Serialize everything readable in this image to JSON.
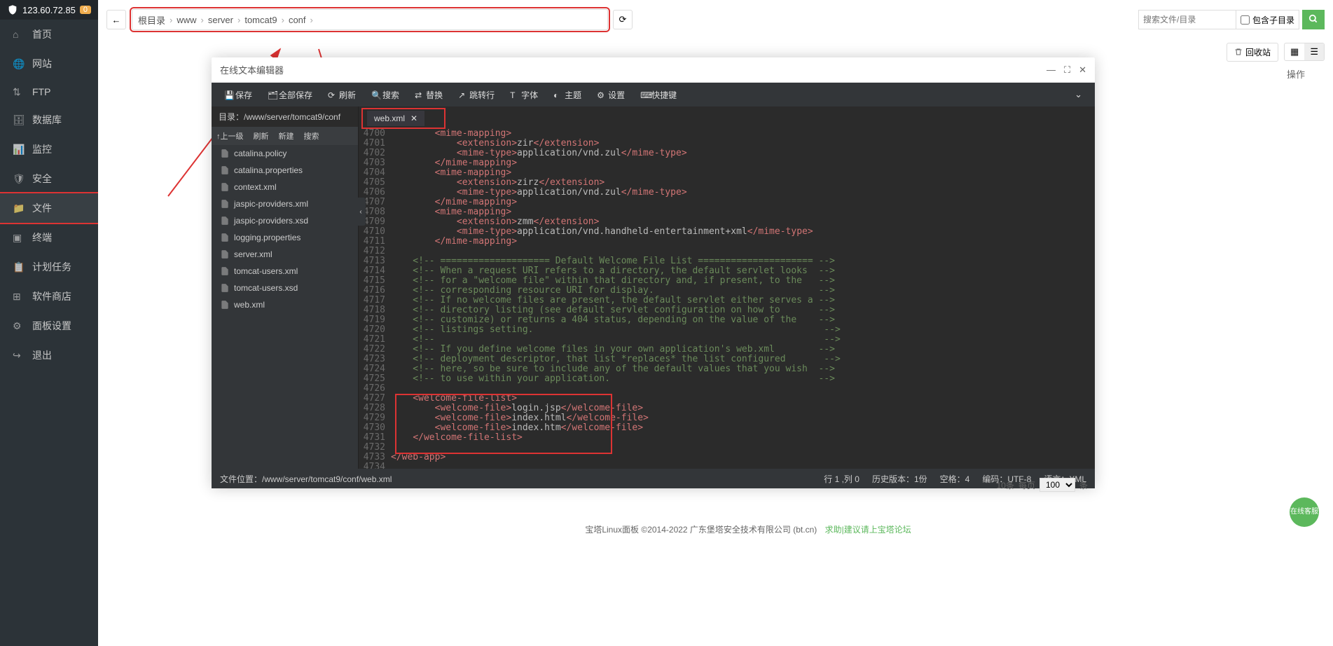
{
  "sidebar": {
    "ip": "123.60.72.85",
    "badge": "0",
    "items": [
      {
        "icon": "home",
        "label": "首页"
      },
      {
        "icon": "globe",
        "label": "网站"
      },
      {
        "icon": "ftp",
        "label": "FTP"
      },
      {
        "icon": "db",
        "label": "数据库"
      },
      {
        "icon": "monitor",
        "label": "监控"
      },
      {
        "icon": "shield",
        "label": "安全"
      },
      {
        "icon": "folder",
        "label": "文件",
        "active": true
      },
      {
        "icon": "terminal",
        "label": "终端"
      },
      {
        "icon": "calendar",
        "label": "计划任务"
      },
      {
        "icon": "apps",
        "label": "软件商店"
      },
      {
        "icon": "gear",
        "label": "面板设置"
      },
      {
        "icon": "exit",
        "label": "退出"
      }
    ]
  },
  "breadcrumb": [
    "根目录",
    "www",
    "server",
    "tomcat9",
    "conf"
  ],
  "search": {
    "placeholder": "搜索文件/目录",
    "subdir": "包含子目录"
  },
  "toolbar": {
    "recycle": "回收站",
    "action": "操作"
  },
  "editor": {
    "title": "在线文本编辑器",
    "menu": [
      {
        "icon": "save",
        "label": "保存"
      },
      {
        "icon": "saveall",
        "label": "全部保存"
      },
      {
        "icon": "refresh",
        "label": "刷新"
      },
      {
        "icon": "search",
        "label": "搜索"
      },
      {
        "icon": "replace",
        "label": "替换"
      },
      {
        "icon": "goto",
        "label": "跳转行"
      },
      {
        "icon": "font",
        "label": "字体"
      },
      {
        "icon": "theme",
        "label": "主题"
      },
      {
        "icon": "settings",
        "label": "设置"
      },
      {
        "icon": "shortcut",
        "label": "快捷键"
      }
    ],
    "treePath": "目录：/www/server/tomcat9/conf",
    "treeToolbar": [
      "↑上一级",
      "刷新",
      "新建",
      "搜索"
    ],
    "files": [
      "catalina.policy",
      "catalina.properties",
      "context.xml",
      "jaspic-providers.xml",
      "jaspic-providers.xsd",
      "logging.properties",
      "server.xml",
      "tomcat-users.xml",
      "tomcat-users.xsd",
      "web.xml"
    ],
    "openTab": "web.xml",
    "code": [
      {
        "n": 4700,
        "h": "        <mime-mapping>",
        "t": "tag"
      },
      {
        "n": 4701,
        "h": "            <extension>zir</extension>",
        "t": "mix"
      },
      {
        "n": 4702,
        "h": "            <mime-type>application/vnd.zul</mime-type>",
        "t": "mix"
      },
      {
        "n": 4703,
        "h": "        </mime-mapping>",
        "t": "tag"
      },
      {
        "n": 4704,
        "h": "        <mime-mapping>",
        "t": "tag"
      },
      {
        "n": 4705,
        "h": "            <extension>zirz</extension>",
        "t": "mix"
      },
      {
        "n": 4706,
        "h": "            <mime-type>application/vnd.zul</mime-type>",
        "t": "mix"
      },
      {
        "n": 4707,
        "h": "        </mime-mapping>",
        "t": "tag"
      },
      {
        "n": 4708,
        "h": "        <mime-mapping>",
        "t": "tag"
      },
      {
        "n": 4709,
        "h": "            <extension>zmm</extension>",
        "t": "mix"
      },
      {
        "n": 4710,
        "h": "            <mime-type>application/vnd.handheld-entertainment+xml</mime-type>",
        "t": "mix"
      },
      {
        "n": 4711,
        "h": "        </mime-mapping>",
        "t": "tag"
      },
      {
        "n": 4712,
        "h": "",
        "t": "text"
      },
      {
        "n": 4713,
        "h": "    <!-- ==================== Default Welcome File List ===================== -->",
        "t": "comment"
      },
      {
        "n": 4714,
        "h": "    <!-- When a request URI refers to a directory, the default servlet looks  -->",
        "t": "comment"
      },
      {
        "n": 4715,
        "h": "    <!-- for a \"welcome file\" within that directory and, if present, to the   -->",
        "t": "comment"
      },
      {
        "n": 4716,
        "h": "    <!-- corresponding resource URI for display.                              -->",
        "t": "comment"
      },
      {
        "n": 4717,
        "h": "    <!-- If no welcome files are present, the default servlet either serves a -->",
        "t": "comment"
      },
      {
        "n": 4718,
        "h": "    <!-- directory listing (see default servlet configuration on how to       -->",
        "t": "comment"
      },
      {
        "n": 4719,
        "h": "    <!-- customize) or returns a 404 status, depending on the value of the    -->",
        "t": "comment"
      },
      {
        "n": 4720,
        "h": "    <!-- listings setting.                                                     -->",
        "t": "comment"
      },
      {
        "n": 4721,
        "h": "    <!--                                                                       -->",
        "t": "comment"
      },
      {
        "n": 4722,
        "h": "    <!-- If you define welcome files in your own application's web.xml        -->",
        "t": "comment"
      },
      {
        "n": 4723,
        "h": "    <!-- deployment descriptor, that list *replaces* the list configured       -->",
        "t": "comment"
      },
      {
        "n": 4724,
        "h": "    <!-- here, so be sure to include any of the default values that you wish  -->",
        "t": "comment"
      },
      {
        "n": 4725,
        "h": "    <!-- to use within your application.                                      -->",
        "t": "comment"
      },
      {
        "n": 4726,
        "h": "",
        "t": "text"
      },
      {
        "n": 4727,
        "h": "    <welcome-file-list>",
        "t": "tag"
      },
      {
        "n": 4728,
        "h": "        <welcome-file>login.jsp</welcome-file>",
        "t": "mix"
      },
      {
        "n": 4729,
        "h": "        <welcome-file>index.html</welcome-file>",
        "t": "mix"
      },
      {
        "n": 4730,
        "h": "        <welcome-file>index.htm</welcome-file>",
        "t": "mix"
      },
      {
        "n": 4731,
        "h": "    </welcome-file-list>",
        "t": "tag"
      },
      {
        "n": 4732,
        "h": "",
        "t": "text"
      },
      {
        "n": 4733,
        "h": "</web-app>",
        "t": "tag"
      },
      {
        "n": 4734,
        "h": "",
        "t": "text"
      }
    ],
    "status": {
      "path": "文件位置：/www/server/tomcat9/conf/web.xml",
      "pos": "行 1 ,列 0",
      "history": "历史版本：1份",
      "space": "空格：4",
      "encoding": "编码：UTF-8",
      "lang": "语言：XML"
    }
  },
  "pager": {
    "info": "10条",
    "per": "每页",
    "count": "100",
    "unit": "条"
  },
  "footer": {
    "text": "宝塔Linux面板 ©2014-2022 广东堡塔安全技术有限公司 (bt.cn)",
    "link": "求助|建议请上宝塔论坛"
  },
  "chat": "在线客服"
}
